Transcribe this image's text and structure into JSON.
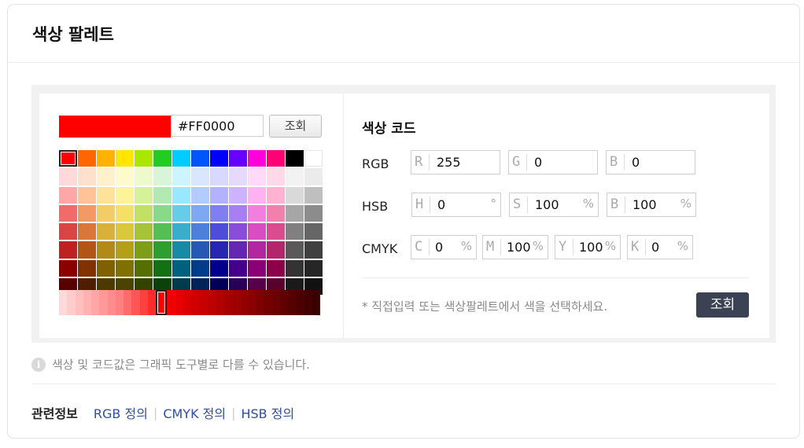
{
  "header": {
    "title": "색상 팔레트"
  },
  "picker": {
    "current_color": "#FF0000",
    "hex_value": "#FF0000",
    "lookup_label": "조회",
    "selected_grid_index": 0,
    "selected_shade_index": 12,
    "grid_colors": [
      [
        "#FF0000",
        "#FF6600",
        "#FFB300",
        "#FFE600",
        "#AAE600",
        "#22CC22",
        "#00CCFF",
        "#0055FF",
        "#0000FF",
        "#6600FF",
        "#FF00DD",
        "#FF0077",
        "#000000",
        "#FFFFFF"
      ],
      [
        "#FFD9D9",
        "#FFE0CC",
        "#FFF0CC",
        "#FFFACC",
        "#EEFACC",
        "#D9F5D9",
        "#CCF5FF",
        "#D9E6FF",
        "#D9D9FF",
        "#E6D9FF",
        "#FFD9F8",
        "#FFD9E8",
        "#F2F2F2",
        "#EBEBEB"
      ],
      [
        "#FFA6A6",
        "#FFC299",
        "#FFE299",
        "#FFF399",
        "#D6F299",
        "#B2E8B2",
        "#99E8FF",
        "#B2CCFF",
        "#B2B2FF",
        "#CCB2FF",
        "#FFB2F1",
        "#FFB2D1",
        "#D9D9D9",
        "#BFBFBF"
      ],
      [
        "#F26B6B",
        "#F29966",
        "#F2CC66",
        "#F2E166",
        "#C2E066",
        "#88D988",
        "#66CCE8",
        "#7FA8F2",
        "#7F7FF2",
        "#A67FF2",
        "#F27FDD",
        "#F27FB0",
        "#A6A6A6",
        "#8C8C8C"
      ],
      [
        "#D94444",
        "#D9773A",
        "#D9B03A",
        "#D9C83A",
        "#A6C33A",
        "#55BF55",
        "#3AADCC",
        "#4D80D9",
        "#4D4DD9",
        "#8A4DD9",
        "#D94DC2",
        "#D94D8E",
        "#808080",
        "#666666"
      ],
      [
        "#BF2020",
        "#B35517",
        "#B38A17",
        "#B3A017",
        "#7F9E17",
        "#2E9E2E",
        "#178BA6",
        "#2659B3",
        "#2626B3",
        "#6426B3",
        "#B326A0",
        "#B3266B",
        "#595959",
        "#404040"
      ],
      [
        "#8C0000",
        "#803300",
        "#806000",
        "#807000",
        "#557000",
        "#137013",
        "#006080",
        "#003B8C",
        "#00008C",
        "#44008C",
        "#8C0077",
        "#8C004A",
        "#333333",
        "#262626"
      ],
      [
        "#590000",
        "#4D1F00",
        "#4D3A00",
        "#4D4300",
        "#334300",
        "#0A430A",
        "#003A4D",
        "#002359",
        "#000059",
        "#290059",
        "#59004A",
        "#59002D",
        "#1A1A1A",
        "#111111"
      ]
    ],
    "shade_colors": [
      "#FFD9D9",
      "#FFCCCC",
      "#FFBFBF",
      "#FFB2B2",
      "#FFA6A6",
      "#FF9999",
      "#FF8C8C",
      "#FF8080",
      "#FF6B6B",
      "#FF5555",
      "#FF4040",
      "#FF2B2B",
      "#FF0000",
      "#F00000",
      "#E60000",
      "#DB0000",
      "#D10000",
      "#C70000",
      "#BD0000",
      "#B30000",
      "#A80000",
      "#9E0000",
      "#940000",
      "#8A0000",
      "#800000",
      "#750000",
      "#6B0000",
      "#610000",
      "#570000",
      "#4D0000",
      "#420000",
      "#380000"
    ]
  },
  "codes": {
    "title": "색상 코드",
    "rgb": {
      "label": "RGB",
      "r": {
        "letter": "R",
        "value": "255"
      },
      "g": {
        "letter": "G",
        "value": "0"
      },
      "b": {
        "letter": "B",
        "value": "0"
      }
    },
    "hsb": {
      "label": "HSB",
      "h": {
        "letter": "H",
        "value": "0",
        "unit": "°"
      },
      "s": {
        "letter": "S",
        "value": "100",
        "unit": "%"
      },
      "b": {
        "letter": "B",
        "value": "100",
        "unit": "%"
      }
    },
    "cmyk": {
      "label": "CMYK",
      "c": {
        "letter": "C",
        "value": "0",
        "unit": "%"
      },
      "m": {
        "letter": "M",
        "value": "100",
        "unit": "%"
      },
      "y": {
        "letter": "Y",
        "value": "100",
        "unit": "%"
      },
      "k": {
        "letter": "K",
        "value": "0",
        "unit": "%"
      }
    },
    "hint": "* 직접입력 또는 색상팔레트에서 색을 선택하세요.",
    "lookup_label": "조회"
  },
  "info": {
    "icon": "info-icon",
    "text": "색상 및 코드값은 그래픽 도구별로 다를 수 있습니다."
  },
  "related": {
    "label": "관련정보",
    "links": [
      "RGB 정의",
      "CMYK 정의",
      "HSB 정의"
    ],
    "separator": "|"
  }
}
